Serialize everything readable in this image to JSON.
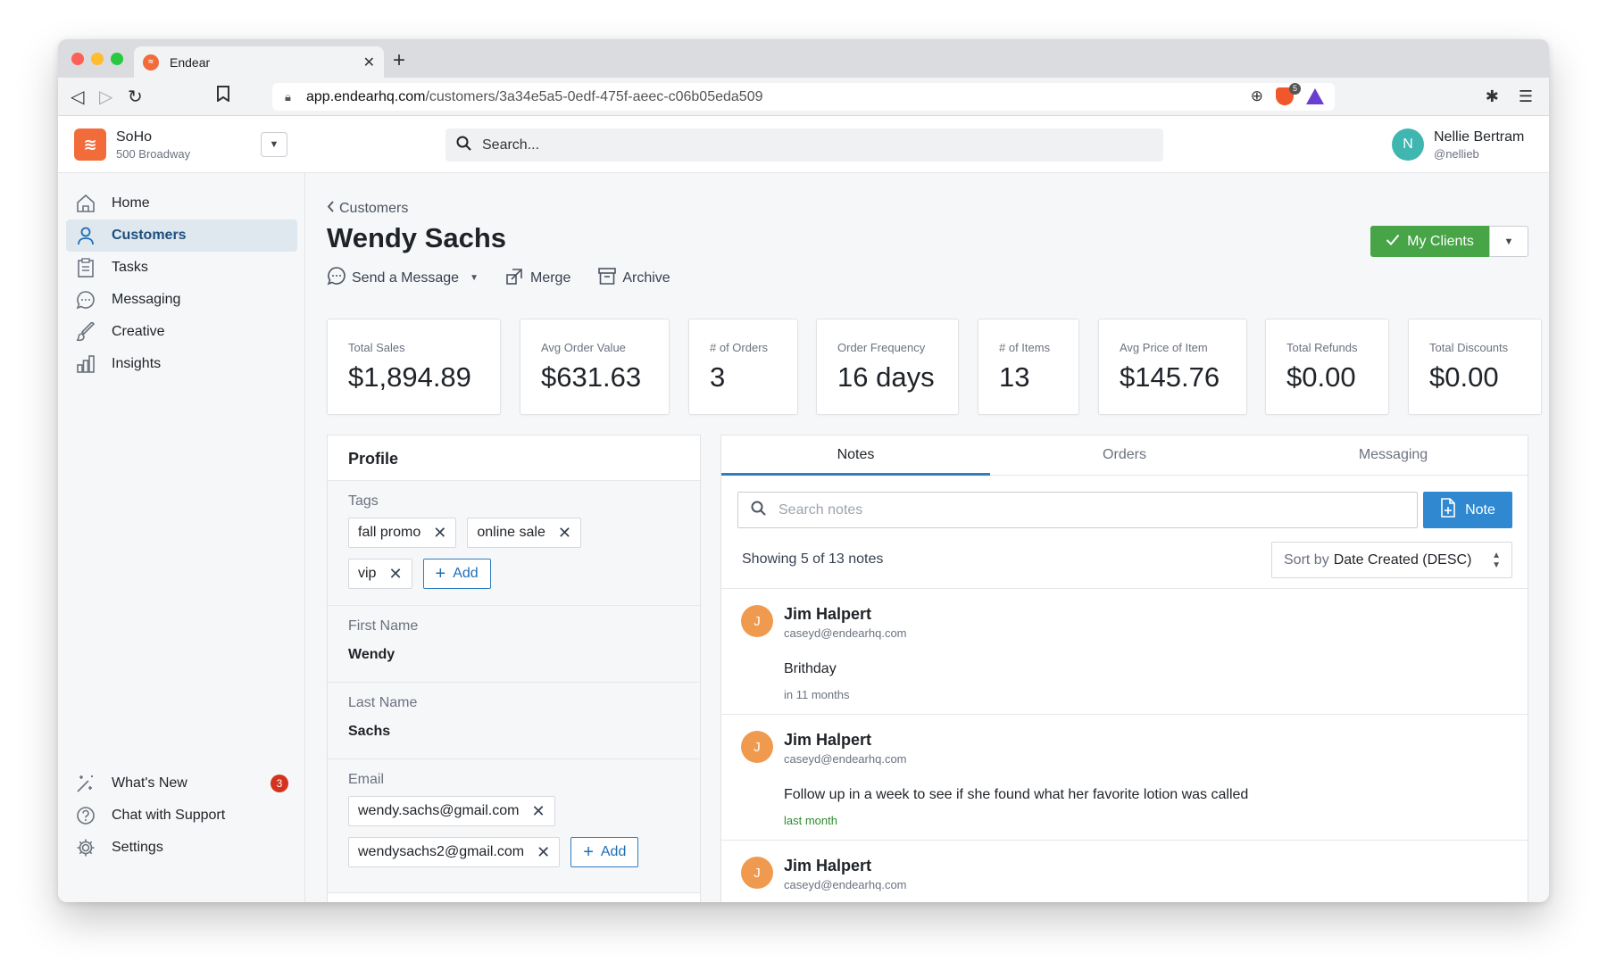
{
  "browser": {
    "tab_title": "Endear",
    "tab_favicon": "endear-logo-icon",
    "url_host": "app.endearhq.com",
    "url_path": "/customers/3a34e5a5-0edf-475f-aeec-c06b05eda509",
    "brave_badge_count": "5"
  },
  "store": {
    "name": "SoHo",
    "address": "500 Broadway"
  },
  "search": {
    "placeholder": "Search..."
  },
  "user": {
    "initial": "N",
    "name": "Nellie Bertram",
    "handle": "@nellieb"
  },
  "sidebar": {
    "items": [
      {
        "label": "Home",
        "icon": "home-icon"
      },
      {
        "label": "Customers",
        "icon": "user-icon",
        "active": true
      },
      {
        "label": "Tasks",
        "icon": "clipboard-icon"
      },
      {
        "label": "Messaging",
        "icon": "chat-icon"
      },
      {
        "label": "Creative",
        "icon": "brush-icon"
      },
      {
        "label": "Insights",
        "icon": "bar-chart-icon"
      }
    ],
    "bottom": [
      {
        "label": "What's New",
        "icon": "sparkle-icon",
        "badge": "3"
      },
      {
        "label": "Chat with Support",
        "icon": "question-icon"
      },
      {
        "label": "Settings",
        "icon": "gear-icon"
      }
    ]
  },
  "page": {
    "breadcrumb": "Customers",
    "title": "Wendy Sachs",
    "actions": {
      "send_message": "Send a Message",
      "merge": "Merge",
      "archive": "Archive"
    },
    "my_clients": "My Clients"
  },
  "stats": [
    {
      "label": "Total Sales",
      "value": "$1,894.89"
    },
    {
      "label": "Avg Order Value",
      "value": "$631.63"
    },
    {
      "label": "# of Orders",
      "value": "3"
    },
    {
      "label": "Order Frequency",
      "value": "16 days"
    },
    {
      "label": "# of Items",
      "value": "13"
    },
    {
      "label": "Avg Price of Item",
      "value": "$145.76"
    },
    {
      "label": "Total Refunds",
      "value": "$0.00"
    },
    {
      "label": "Total Discounts",
      "value": "$0.00"
    }
  ],
  "profile": {
    "title": "Profile",
    "tags_label": "Tags",
    "tags": [
      "fall promo",
      "online sale",
      "vip"
    ],
    "add_label": "Add",
    "first_name_label": "First Name",
    "first_name": "Wendy",
    "last_name_label": "Last Name",
    "last_name": "Sachs",
    "email_label": "Email",
    "emails": [
      "wendy.sachs@gmail.com",
      "wendysachs2@gmail.com"
    ]
  },
  "notes": {
    "tabs": [
      "Notes",
      "Orders",
      "Messaging"
    ],
    "active_tab": "Notes",
    "search_placeholder": "Search notes",
    "new_note_label": "Note",
    "showing": "Showing 5 of 13 notes",
    "sort_prefix": "Sort by",
    "sort_value": "Date Created (DESC)",
    "items": [
      {
        "initial": "J",
        "author": "Jim Halpert",
        "email": "caseyd@endearhq.com",
        "text": "Brithday",
        "time": "in 11 months",
        "time_color": "gray"
      },
      {
        "initial": "J",
        "author": "Jim Halpert",
        "email": "caseyd@endearhq.com",
        "text": "Follow up in a week to see if she found what her favorite lotion was called",
        "time": "last month",
        "time_color": "green"
      },
      {
        "initial": "J",
        "author": "Jim Halpert",
        "email": "caseyd@endearhq.com",
        "text": "",
        "time": "",
        "time_color": "gray"
      }
    ]
  },
  "colors": {
    "accent_blue": "#2f88d0",
    "success_green": "#47a447",
    "brand_orange": "#f26b3a",
    "badge_red": "#d4341f"
  }
}
